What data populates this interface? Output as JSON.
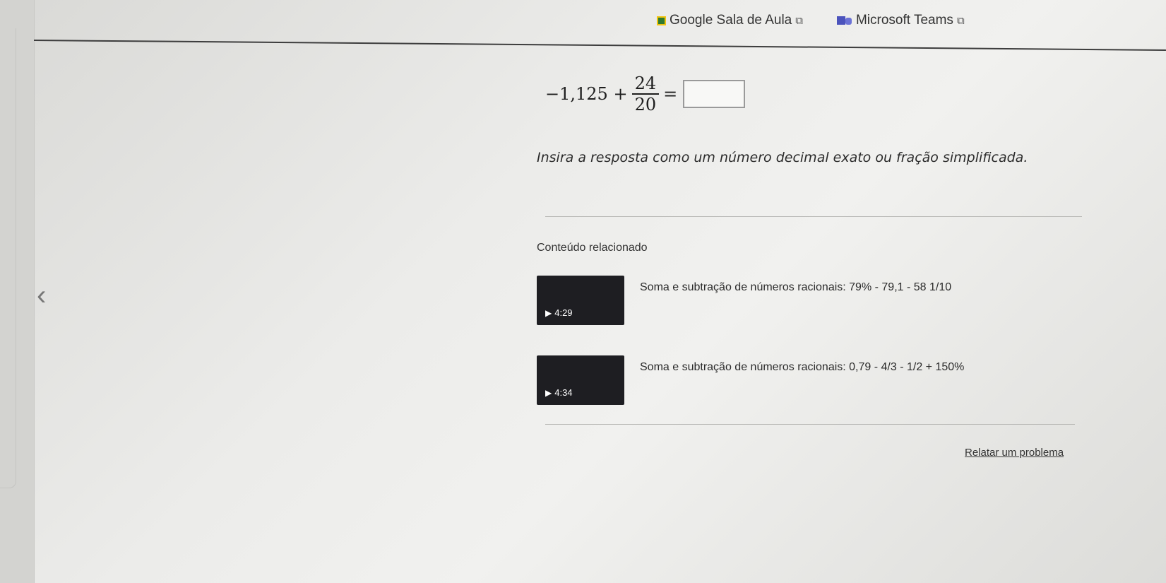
{
  "header": {
    "links": [
      {
        "label": "Google Sala de Aula",
        "icon": "google-classroom-icon"
      },
      {
        "label": "Microsoft Teams",
        "icon": "microsoft-teams-icon"
      }
    ],
    "external_icon": "external-link-icon"
  },
  "problem": {
    "lhs_number": "−1,125 +",
    "numerator": "24",
    "denominator": "20",
    "equals": "=",
    "answer_value": "",
    "instruction": "Insira a resposta como um número decimal exato ou fração simplificada."
  },
  "related": {
    "title": "Conteúdo relacionado",
    "videos": [
      {
        "duration": "4:29",
        "title": "Soma e subtração de números racionais: 79% - 79,1 - 58 1/10"
      },
      {
        "duration": "4:34",
        "title": "Soma e subtração de números racionais: 0,79 - 4/3 - 1/2 + 150%"
      }
    ]
  },
  "footer": {
    "report_label": "Relatar um problema"
  },
  "icons": {
    "back": "chevron-left-icon",
    "play": "play-icon"
  },
  "colors": {
    "page_bg": "#ececea",
    "thumb_bg": "#1e1e22",
    "teams": "#4b53bc",
    "classroom": "#2f7a2f"
  }
}
